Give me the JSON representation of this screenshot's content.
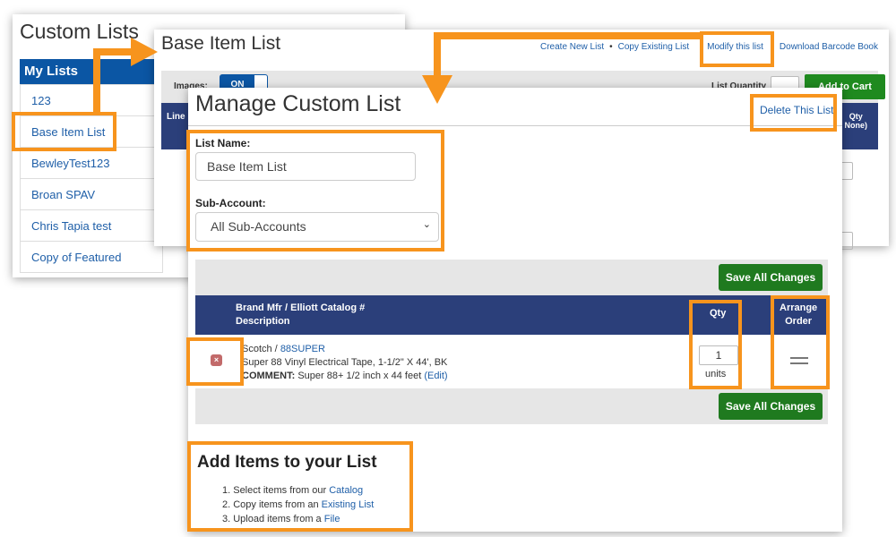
{
  "custom_lists": {
    "title": "Custom Lists",
    "my_lists_header": "My Lists",
    "items": [
      "123",
      "Base Item List",
      "BewleyTest123",
      "Broan SPAV",
      "Chris Tapia test",
      "Copy of Featured"
    ]
  },
  "base_list": {
    "title": "Base Item List",
    "links": {
      "create": "Create New List",
      "dot": "•",
      "copy": "Copy Existing List",
      "modify": "Modify this list",
      "download": "Download Barcode Book"
    },
    "images_label": "Images:",
    "toggle_on": "ON",
    "list_quantity_label": "List Quantity",
    "add_to_cart": "Add to Cart",
    "header_line": "Line I",
    "header_qty": "Qty",
    "header_qty_sub": "None)"
  },
  "manage": {
    "title": "Manage Custom List",
    "delete_link": "Delete This List",
    "list_name_label": "List Name:",
    "list_name_value": "Base Item List",
    "sub_account_label": "Sub-Account:",
    "sub_account_value": "All Sub-Accounts",
    "save_label": "Save All Changes",
    "table": {
      "brand_header": "Brand Mfr / Elliott Catalog #",
      "desc_header": "Description",
      "qty_header": "Qty",
      "arrange_header_1": "Arrange",
      "arrange_header_2": "Order"
    },
    "row": {
      "brand": "Scotch /",
      "catalog": "88SUPER",
      "description": "Super 88 Vinyl Electrical Tape, 1-1/2\" X 44', BK",
      "comment_label": "COMMENT:",
      "comment": "Super 88+ 1/2 inch x 44 feet",
      "edit": "(Edit)",
      "qty": "1",
      "units": "units"
    },
    "add_items": {
      "title": "Add Items to your List",
      "step1_prefix": "1. Select items from our",
      "step1_link": "Catalog",
      "step2_prefix": "2. Copy items from an",
      "step2_link": "Existing List",
      "step3_prefix": "3. Upload items from a",
      "step3_link": "File"
    }
  },
  "colors": {
    "highlight": "#f7941d",
    "brand_blue": "#0b56a4",
    "header_navy": "#2b3f7a",
    "save_green": "#1f7a1f"
  }
}
